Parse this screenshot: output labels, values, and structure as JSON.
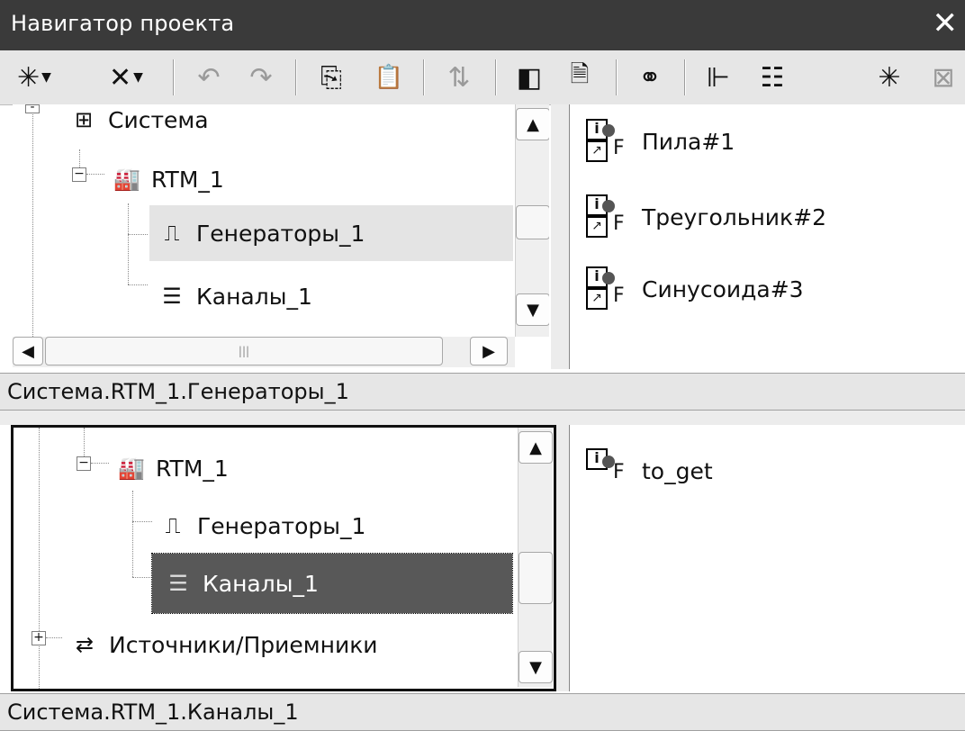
{
  "window": {
    "title": "Навигатор проекта",
    "close_glyph": "✕"
  },
  "toolbar": {
    "buttons": [
      {
        "name": "new-item-icon",
        "glyph": "✳"
      },
      {
        "name": "delete-icon",
        "glyph": "✕"
      },
      {
        "name": "undo-icon",
        "glyph": "↶"
      },
      {
        "name": "redo-icon",
        "glyph": "↷"
      },
      {
        "name": "copy-icon",
        "glyph": "⎘"
      },
      {
        "name": "paste-icon",
        "glyph": "📋"
      },
      {
        "name": "move-icon",
        "glyph": "⇅"
      },
      {
        "name": "view-icon",
        "glyph": "◧"
      },
      {
        "name": "properties-icon",
        "glyph": "🗎"
      },
      {
        "name": "find-icon",
        "glyph": "⚭"
      },
      {
        "name": "tree-view-icon",
        "glyph": "⊩"
      },
      {
        "name": "list-view-icon",
        "glyph": "☷"
      },
      {
        "name": "new-window-icon",
        "glyph": "✳"
      },
      {
        "name": "close-panel-icon",
        "glyph": "⊠"
      }
    ]
  },
  "top_tree": {
    "nodes": [
      "Система",
      "RTM_1",
      "Генераторы_1",
      "Каналы_1"
    ],
    "selected": "Генераторы_1"
  },
  "top_list": {
    "items": [
      "Пила#1",
      "Треугольник#2",
      "Синусоида#3"
    ]
  },
  "status_top": "Система.RTM_1.Генераторы_1",
  "bottom_tree": {
    "nodes": [
      "RTM_1",
      "Генераторы_1",
      "Каналы_1",
      "Источники/Приемники"
    ],
    "selected": "Каналы_1"
  },
  "bottom_list": {
    "items": [
      "to_get"
    ]
  },
  "status_bottom": "Система.RTM_1.Каналы_1",
  "colors": {
    "titlebar": "#3a3a3a",
    "selected_active": "#585858",
    "selected_inactive": "#e4e4e4"
  }
}
